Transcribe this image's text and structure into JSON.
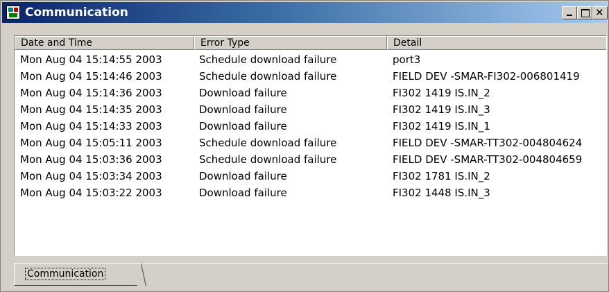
{
  "window": {
    "title": "Communication"
  },
  "columns": [
    "Date and Time",
    "Error Type",
    "Detail"
  ],
  "rows": [
    [
      "Mon Aug 04 15:14:55 2003",
      "Schedule download failure",
      "port3"
    ],
    [
      "Mon Aug 04 15:14:46 2003",
      "Schedule download failure",
      "FIELD DEV -SMAR-FI302-006801419"
    ],
    [
      "Mon Aug 04 15:14:36 2003",
      "Download failure",
      "FI302 1419 IS.IN_2"
    ],
    [
      "Mon Aug 04 15:14:35 2003",
      "Download failure",
      "FI302 1419 IS.IN_3"
    ],
    [
      "Mon Aug 04 15:14:33 2003",
      "Download failure",
      "FI302 1419 IS.IN_1"
    ],
    [
      "Mon Aug 04 15:05:11 2003",
      "Schedule download failure",
      "FIELD DEV -SMAR-TT302-004804624"
    ],
    [
      "Mon Aug 04 15:03:36 2003",
      "Schedule download failure",
      "FIELD DEV -SMAR-TT302-004804659"
    ],
    [
      "Mon Aug 04 15:03:34 2003",
      "Download failure",
      "FI302 1781 IS.IN_2"
    ],
    [
      "Mon Aug 04 15:03:22 2003",
      "Download failure",
      "FI302 1448 IS.IN_3"
    ]
  ],
  "tabs": [
    {
      "label": "Communication"
    }
  ],
  "icons": {
    "app": "app-icon",
    "minimize": "minimize-icon",
    "maximize": "maximize-icon",
    "close": "close-icon"
  }
}
